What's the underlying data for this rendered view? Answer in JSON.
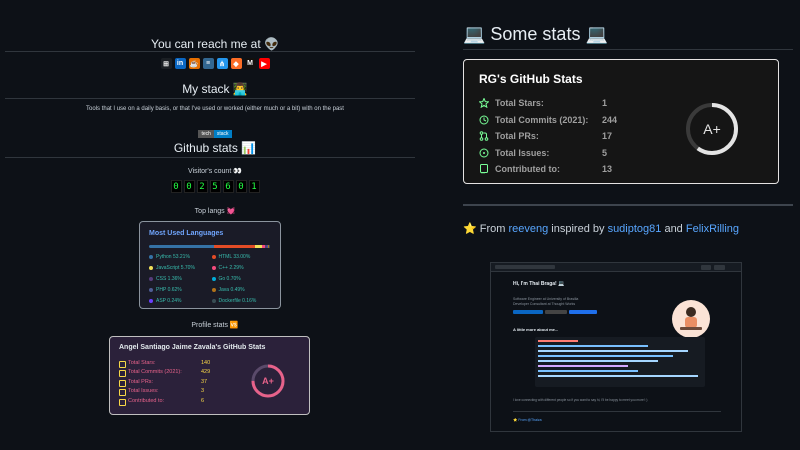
{
  "left": {
    "reach_heading": "You can reach me at 👽",
    "contact_icons": [
      {
        "name": "stackoverflow-icon",
        "glyph": "⊞",
        "color": "#1b1f24"
      },
      {
        "name": "linkedin-icon",
        "glyph": "in",
        "color": "#0a66c2"
      },
      {
        "name": "java-icon",
        "glyph": "☕",
        "color": "#e76f00"
      },
      {
        "name": "database-icon",
        "glyph": "≡",
        "color": "#336791"
      },
      {
        "name": "blocks-icon",
        "glyph": "⋔",
        "color": "#2496ed"
      },
      {
        "name": "gitlab-icon",
        "glyph": "◆",
        "color": "#fc6d26"
      },
      {
        "name": "medium-icon",
        "glyph": "M",
        "color": "#12100e"
      },
      {
        "name": "youtube-icon",
        "glyph": "▶",
        "color": "#ff0000"
      }
    ],
    "stack_heading": "My stack 👨‍💻",
    "stack_desc": "Tools that I use on a daily basis, or that I've used or worked (either much or a bit) with on the past",
    "badge_left": "tech",
    "badge_right": "stack",
    "github_heading": "Github stats 📊",
    "visitors_label": "Visitor's count 👀",
    "visitor_digits": [
      "0",
      "0",
      "2",
      "5",
      "6",
      "0",
      "1"
    ],
    "top_langs_label": "Top langs 💓",
    "langs_card": {
      "title": "Most Used Languages",
      "languages": [
        {
          "name": "Python",
          "percent": "53.21%",
          "color": "#3572a5",
          "share": 53.21
        },
        {
          "name": "HTML",
          "percent": "33.00%",
          "color": "#e34c26",
          "share": 33.0
        },
        {
          "name": "JavaScript",
          "percent": "5.70%",
          "color": "#f1e05a",
          "share": 5.7
        },
        {
          "name": "C++",
          "percent": "2.29%",
          "color": "#f34b7d",
          "share": 2.29
        },
        {
          "name": "CSS",
          "percent": "1.36%",
          "color": "#563d7c",
          "share": 1.36
        },
        {
          "name": "Go",
          "percent": "0.70%",
          "color": "#00add8",
          "share": 0.7
        },
        {
          "name": "PHP",
          "percent": "0.62%",
          "color": "#4f5d95",
          "share": 0.62
        },
        {
          "name": "Java",
          "percent": "0.49%",
          "color": "#b07219",
          "share": 0.49
        },
        {
          "name": "ASP",
          "percent": "0.24%",
          "color": "#6a40fd",
          "share": 0.24
        },
        {
          "name": "Dockerfile",
          "percent": "0.16%",
          "color": "#384d54",
          "share": 0.16
        }
      ]
    },
    "profile_label": "Profile stats 🆚",
    "profile_card": {
      "title": "Angel Santiago Jaime Zavala's GitHub Stats",
      "rows": [
        {
          "label": "Total Stars:",
          "value": "140"
        },
        {
          "label": "Total Commits (2021):",
          "value": "429"
        },
        {
          "label": "Total PRs:",
          "value": "37"
        },
        {
          "label": "Total Issues:",
          "value": "3"
        },
        {
          "label": "Contributed to:",
          "value": "6"
        }
      ],
      "grade": "A+",
      "grade_progress": 0.75
    }
  },
  "right": {
    "heading": "💻 Some stats 💻",
    "rg_card": {
      "title": "RG's GitHub Stats",
      "rows": [
        {
          "label": "Total Stars:",
          "value": "1",
          "icon": "star-icon"
        },
        {
          "label": "Total Commits (2021):",
          "value": "244",
          "icon": "history-icon"
        },
        {
          "label": "Total PRs:",
          "value": "17",
          "icon": "pull-request-icon"
        },
        {
          "label": "Total Issues:",
          "value": "5",
          "icon": "issue-icon"
        },
        {
          "label": "Contributed to:",
          "value": "13",
          "icon": "repo-icon"
        }
      ],
      "grade": "A+",
      "grade_progress": 0.6
    },
    "credit": {
      "prefix": "⭐ From ",
      "from_link": "reeveng",
      "middle": " inspired by ",
      "link1": "sudiptog81",
      "and": " and ",
      "link2": "FelixRilling"
    },
    "preview": {
      "greeting": "Hi, I'm Thai Braga! 💻",
      "intro_line1": "Software Engineer at University of Brasilia",
      "intro_line2": "Developer Consultant at Thought Works",
      "more_about": "A little more about me...",
      "footer_text": "I love connecting with different people so if you want to say hi, I'll be happy to meet you more! :)",
      "from_line": "⭐ From @Thaiza"
    }
  }
}
